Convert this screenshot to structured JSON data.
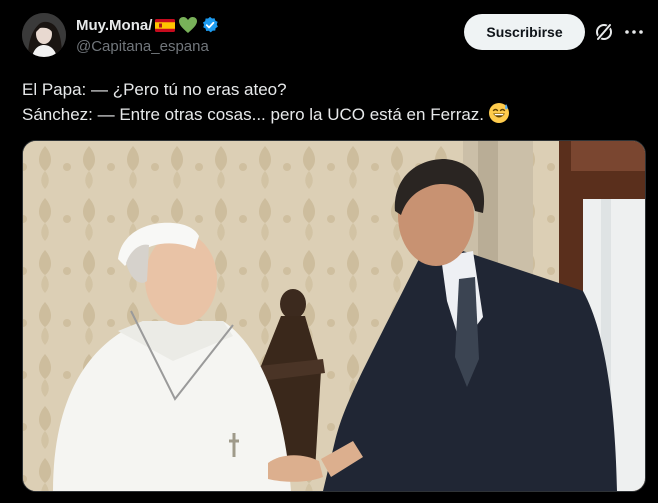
{
  "post": {
    "display_name": "Muy.Mona/",
    "handle": "@Capitana_espana",
    "subscribe_label": "Suscribirse",
    "text_line_1": "El Papa: — ¿Pero tú no eras ateo?",
    "text_line_2": "Sánchez: — Entre otras cosas... pero la UCO está en Ferraz."
  },
  "icons": {
    "flag": "spain-flag-icon",
    "heart": "green-heart-icon",
    "verified": "verified-badge-icon",
    "grok": "grok-icon",
    "more": "more-options-icon",
    "emoji": "sweat-smile-emoji"
  },
  "colors": {
    "background": "#000000",
    "text": "#e7e9ea",
    "secondary_text": "#71767b",
    "verified_blue": "#1d9bf0",
    "button_bg": "#eff3f4",
    "border": "#2f3336"
  }
}
